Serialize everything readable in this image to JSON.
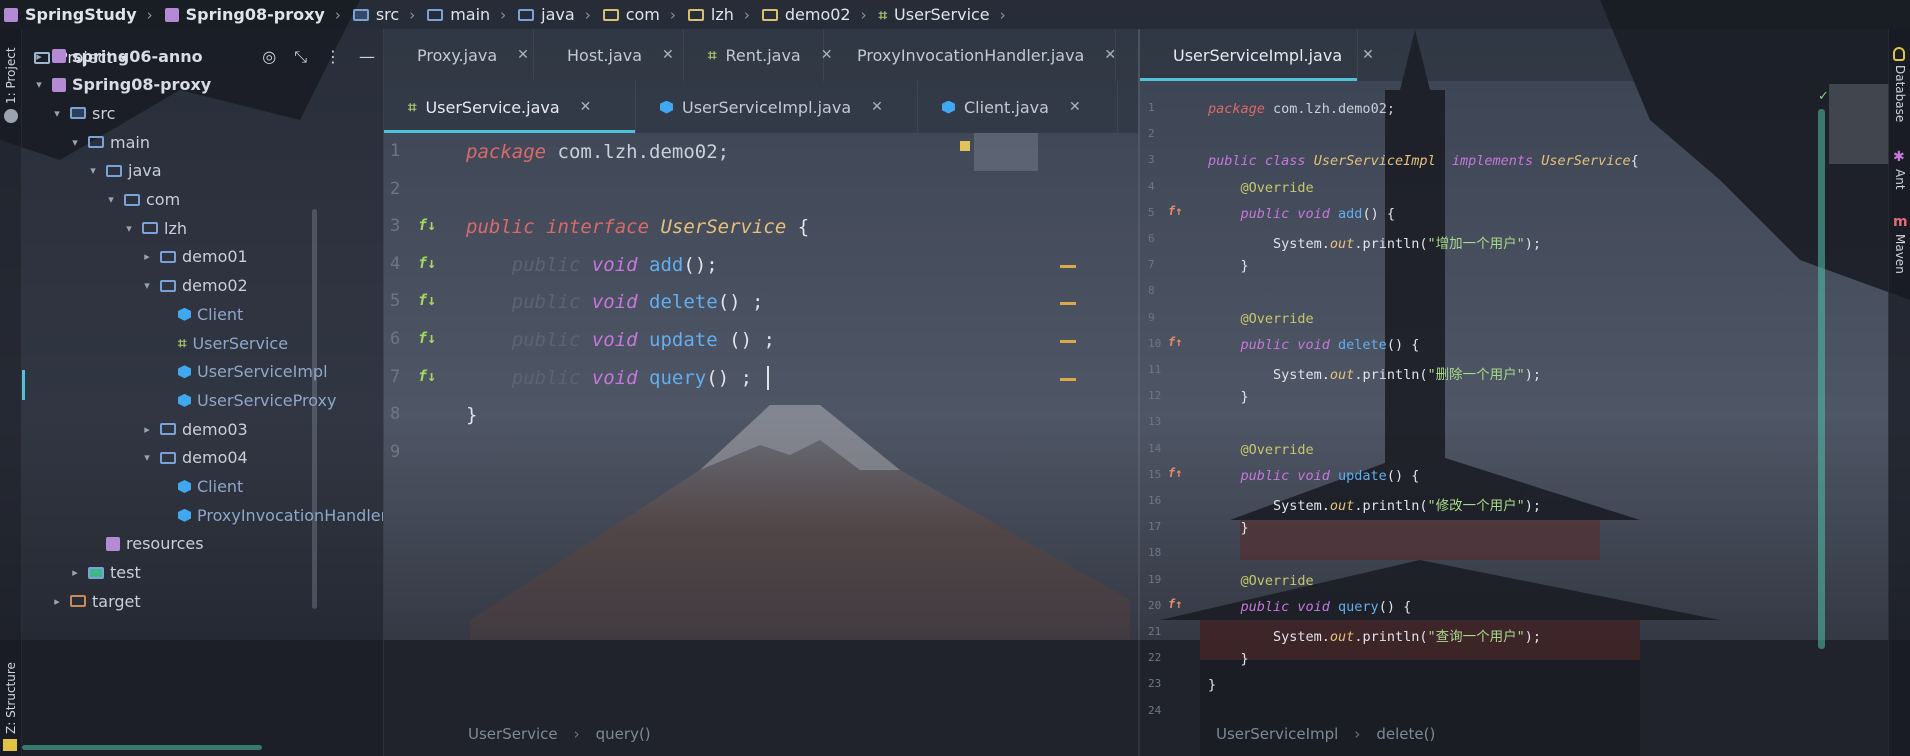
{
  "breadcrumb": [
    {
      "label": "SpringStudy",
      "icon": "module-icon",
      "bold": true
    },
    {
      "label": "Spring08-proxy",
      "icon": "module-icon",
      "bold": true
    },
    {
      "label": "src",
      "icon": "source-folder-icon"
    },
    {
      "label": "main",
      "icon": "folder-icon"
    },
    {
      "label": "java",
      "icon": "folder-icon"
    },
    {
      "label": "com",
      "icon": "package-icon"
    },
    {
      "label": "lzh",
      "icon": "package-icon"
    },
    {
      "label": "demo02",
      "icon": "package-icon"
    },
    {
      "label": "UserService",
      "icon": "interface-icon"
    }
  ],
  "left_stripe": {
    "project_tab": "1: Project",
    "structure_tab": "Z: Structure"
  },
  "right_stripe": {
    "database": "Database",
    "ant": "Ant",
    "maven": "Maven"
  },
  "project_panel": {
    "title": "Project",
    "tree": [
      {
        "label": "spring06-anno",
        "depth": 1,
        "arrow": "›",
        "icon": "module",
        "bold": true
      },
      {
        "label": "Spring08-proxy",
        "depth": 1,
        "arrow": "⌄",
        "icon": "module",
        "bold": true
      },
      {
        "label": "src",
        "depth": 2,
        "arrow": "⌄",
        "icon": "src"
      },
      {
        "label": "main",
        "depth": 3,
        "arrow": "⌄",
        "icon": "folder"
      },
      {
        "label": "java",
        "depth": 4,
        "arrow": "⌄",
        "icon": "folder"
      },
      {
        "label": "com",
        "depth": 5,
        "arrow": "⌄",
        "icon": "folder"
      },
      {
        "label": "lzh",
        "depth": 6,
        "arrow": "⌄",
        "icon": "folder"
      },
      {
        "label": "demo01",
        "depth": 7,
        "arrow": "›",
        "icon": "folder"
      },
      {
        "label": "demo02",
        "depth": 7,
        "arrow": "⌄",
        "icon": "folder"
      },
      {
        "label": "Client",
        "depth": 8,
        "arrow": "",
        "icon": "class"
      },
      {
        "label": "UserService",
        "depth": 8,
        "arrow": "",
        "icon": "interface"
      },
      {
        "label": "UserServiceImpl",
        "depth": 8,
        "arrow": "",
        "icon": "class"
      },
      {
        "label": "UserServiceProxy",
        "depth": 8,
        "arrow": "",
        "icon": "class"
      },
      {
        "label": "demo03",
        "depth": 7,
        "arrow": "›",
        "icon": "folder"
      },
      {
        "label": "demo04",
        "depth": 7,
        "arrow": "⌄",
        "icon": "folder"
      },
      {
        "label": "Client",
        "depth": 8,
        "arrow": "",
        "icon": "class"
      },
      {
        "label": "ProxyInvocationHandler",
        "depth": 8,
        "arrow": "",
        "icon": "class"
      },
      {
        "label": "resources",
        "depth": 4,
        "arrow": "",
        "icon": "resources"
      },
      {
        "label": "test",
        "depth": 3,
        "arrow": "›",
        "icon": "test"
      },
      {
        "label": "target",
        "depth": 2,
        "arrow": "›",
        "icon": "target"
      }
    ]
  },
  "left_editor": {
    "tabs_row1": [
      {
        "label": "Proxy.java",
        "icon": "class"
      },
      {
        "label": "Host.java",
        "icon": "class"
      },
      {
        "label": "Rent.java",
        "icon": "interface"
      },
      {
        "label": "ProxyInvocationHandler.java",
        "icon": "class"
      }
    ],
    "tabs_row2": [
      {
        "label": "UserService.java",
        "icon": "interface",
        "active": true
      },
      {
        "label": "UserServiceImpl.java",
        "icon": "class"
      },
      {
        "label": "Client.java",
        "icon": "class"
      }
    ],
    "line_numbers": [
      "1",
      "2",
      "3",
      "4",
      "5",
      "6",
      "7",
      "8",
      "9"
    ],
    "lines": [
      [
        {
          "t": "package ",
          "c": "kw"
        },
        {
          "t": "com.lzh.demo02;",
          "c": "pkgname"
        }
      ],
      [],
      [
        {
          "t": "public ",
          "c": "kw"
        },
        {
          "t": "interface ",
          "c": "kw"
        },
        {
          "t": "UserService ",
          "c": "type"
        },
        {
          "t": "{",
          "c": "plain"
        }
      ],
      [
        {
          "t": "    public ",
          "c": "dim"
        },
        {
          "t": "void ",
          "c": "kw2"
        },
        {
          "t": "add",
          "c": "fn"
        },
        {
          "t": "();",
          "c": "plain"
        }
      ],
      [
        {
          "t": "    public ",
          "c": "dim"
        },
        {
          "t": "void ",
          "c": "kw2"
        },
        {
          "t": "delete",
          "c": "fn"
        },
        {
          "t": "() ;",
          "c": "plain"
        }
      ],
      [
        {
          "t": "    public ",
          "c": "dim"
        },
        {
          "t": "void ",
          "c": "kw2"
        },
        {
          "t": "update",
          "c": "fn"
        },
        {
          "t": " () ;",
          "c": "plain"
        }
      ],
      [
        {
          "t": "    public ",
          "c": "dim"
        },
        {
          "t": "void ",
          "c": "kw2"
        },
        {
          "t": "query",
          "c": "fn"
        },
        {
          "t": "() ;",
          "c": "plain"
        }
      ],
      [
        {
          "t": "}",
          "c": "plain"
        }
      ],
      []
    ],
    "status": [
      "UserService",
      "query()"
    ]
  },
  "right_editor": {
    "tabs": [
      {
        "label": "UserServiceImpl.java",
        "icon": "class",
        "active": true
      }
    ],
    "line_numbers": [
      "1",
      "2",
      "3",
      "4",
      "5",
      "6",
      "7",
      "8",
      "9",
      "10",
      "11",
      "12",
      "13",
      "14",
      "15",
      "16",
      "17",
      "18",
      "19",
      "20",
      "21",
      "22",
      "23",
      "24"
    ],
    "lines": [
      [
        {
          "t": "package ",
          "c": "kw"
        },
        {
          "t": "com.lzh.demo02;",
          "c": "pkgname"
        }
      ],
      [],
      [
        {
          "t": "public ",
          "c": "kw2"
        },
        {
          "t": "class ",
          "c": "kw2"
        },
        {
          "t": "UserServiceImpl  ",
          "c": "type"
        },
        {
          "t": "implements ",
          "c": "kw2"
        },
        {
          "t": "UserService",
          "c": "type"
        },
        {
          "t": "{",
          "c": "plain"
        }
      ],
      [
        {
          "t": "    @Override",
          "c": "ann"
        }
      ],
      [
        {
          "t": "    public ",
          "c": "kw2"
        },
        {
          "t": "void ",
          "c": "kw2"
        },
        {
          "t": "add",
          "c": "fn"
        },
        {
          "t": "() {",
          "c": "plain"
        }
      ],
      [
        {
          "t": "        System.",
          "c": "plain"
        },
        {
          "t": "out",
          "c": "field"
        },
        {
          "t": ".println(",
          "c": "plain"
        },
        {
          "t": "\"增加一个用户\"",
          "c": "str"
        },
        {
          "t": ");",
          "c": "plain"
        }
      ],
      [
        {
          "t": "    }",
          "c": "plain"
        }
      ],
      [],
      [
        {
          "t": "    @Override",
          "c": "ann"
        }
      ],
      [
        {
          "t": "    public ",
          "c": "kw2"
        },
        {
          "t": "void ",
          "c": "kw2"
        },
        {
          "t": "delete",
          "c": "fn"
        },
        {
          "t": "() {",
          "c": "plain"
        }
      ],
      [
        {
          "t": "        System.",
          "c": "plain"
        },
        {
          "t": "out",
          "c": "field"
        },
        {
          "t": ".println(",
          "c": "plain"
        },
        {
          "t": "\"删除一个用户\"",
          "c": "str"
        },
        {
          "t": ");",
          "c": "plain"
        }
      ],
      [
        {
          "t": "    }",
          "c": "plain"
        }
      ],
      [],
      [
        {
          "t": "    @Override",
          "c": "ann"
        }
      ],
      [
        {
          "t": "    public ",
          "c": "kw2"
        },
        {
          "t": "void ",
          "c": "kw2"
        },
        {
          "t": "update",
          "c": "fn"
        },
        {
          "t": "() {",
          "c": "plain"
        }
      ],
      [
        {
          "t": "        System.",
          "c": "plain"
        },
        {
          "t": "out",
          "c": "field"
        },
        {
          "t": ".println(",
          "c": "plain"
        },
        {
          "t": "\"修改一个用户\"",
          "c": "str"
        },
        {
          "t": ");",
          "c": "plain"
        }
      ],
      [
        {
          "t": "    }",
          "c": "plain"
        }
      ],
      [],
      [
        {
          "t": "    @Override",
          "c": "ann"
        }
      ],
      [
        {
          "t": "    public ",
          "c": "kw2"
        },
        {
          "t": "void ",
          "c": "kw2"
        },
        {
          "t": "query",
          "c": "fn"
        },
        {
          "t": "() {",
          "c": "plain"
        }
      ],
      [
        {
          "t": "        System.",
          "c": "plain"
        },
        {
          "t": "out",
          "c": "field"
        },
        {
          "t": ".println(",
          "c": "plain"
        },
        {
          "t": "\"查询一个用户\"",
          "c": "str"
        },
        {
          "t": ");",
          "c": "plain"
        }
      ],
      [
        {
          "t": "    }",
          "c": "plain"
        }
      ],
      [
        {
          "t": "}",
          "c": "plain"
        }
      ],
      []
    ],
    "status": [
      "UserServiceImpl",
      "delete()"
    ]
  },
  "colors": {
    "accent": "#4fc1d9",
    "keyword": "#d96a6a",
    "type": "#e5c07b",
    "method": "#61afef",
    "string": "#a8d88a"
  }
}
